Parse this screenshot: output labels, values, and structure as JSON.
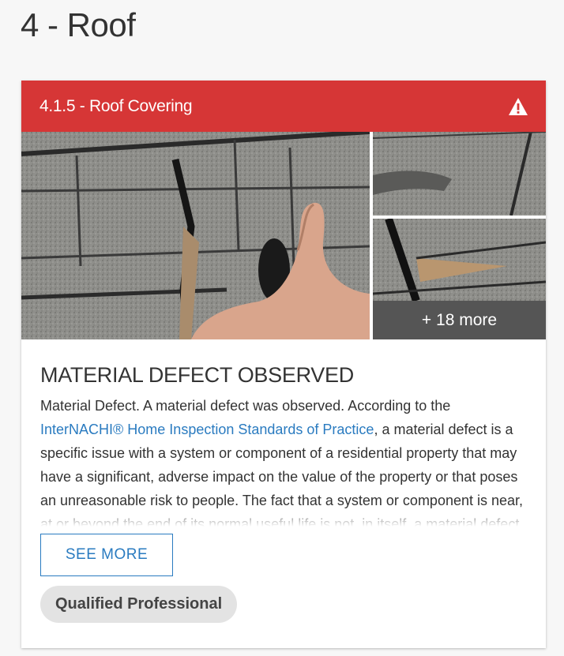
{
  "section": {
    "title": "4 - Roof"
  },
  "card": {
    "header": {
      "title": "4.1.5 - Roof Covering",
      "icon": "warning-icon",
      "color": "#d63636"
    },
    "photos": {
      "more_label": "+ 18 more"
    },
    "defect": {
      "title": "MATERIAL DEFECT OBSERVED",
      "text_before_link": "Material Defect. A material defect was observed. According to the ",
      "link_text": "InterNACHI® Home Inspection Standards of Practice",
      "text_after_link": ", a material defect is a specific issue with a system or component of a residential property that may have a significant, adverse impact on the value of the property or that poses an unreasonable risk to people. The fact that a system or component is near, at or beyond the end of its normal useful life is not, in itself, a material defect."
    },
    "see_more_label": "SEE MORE",
    "badge_label": "Qualified Professional"
  }
}
